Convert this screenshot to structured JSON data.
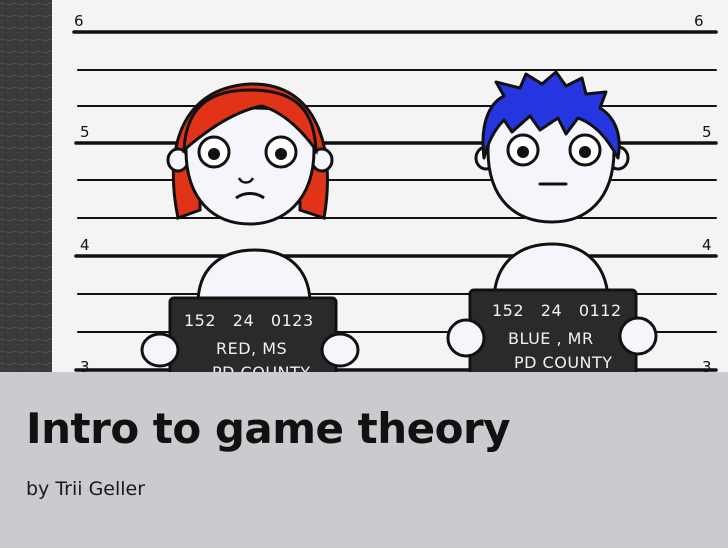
{
  "hero": {
    "height_marks": [
      "6",
      "6",
      "5",
      "5",
      "4",
      "4",
      "3",
      "3"
    ],
    "suspect_left": {
      "line1": "152   24   0123",
      "line2": "RED, MS",
      "line3": "PD COUNTY",
      "hair_color": "#e03318"
    },
    "suspect_right": {
      "line1": "152   24   0112",
      "line2": "BLUE , MR",
      "line3": "PD COUNTY",
      "hair_color": "#2536e0"
    },
    "colors": {
      "wall": "#f4f4f4",
      "line": "#111111",
      "placard": "#2a2a2a",
      "chalkboard": "#3a3a3a"
    }
  },
  "title": "Intro to game theory",
  "byline": "by Trii Geller",
  "colors": {
    "footer_bg": "#cbcbcf",
    "title_text": "#111111"
  }
}
